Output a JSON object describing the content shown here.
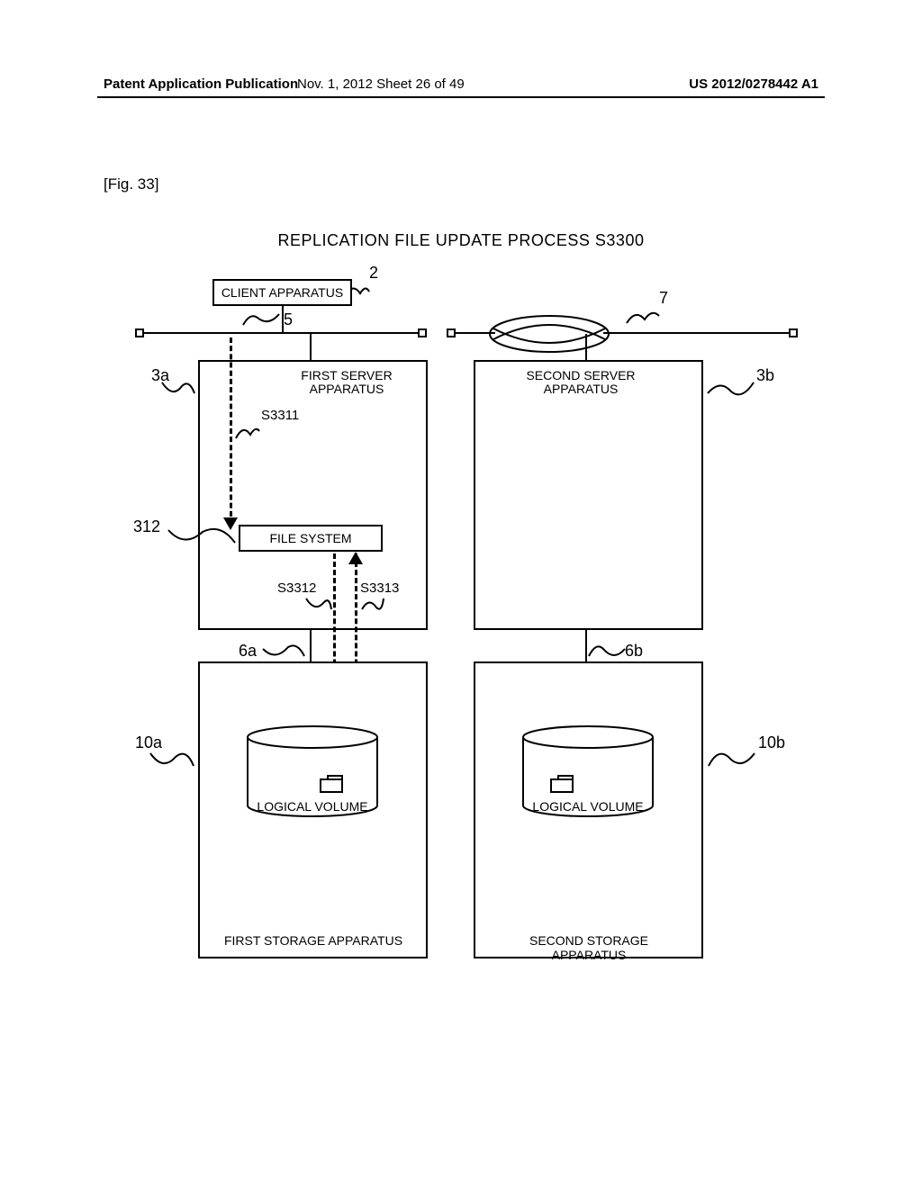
{
  "header": {
    "left": "Patent Application Publication",
    "center": "Nov. 1, 2012  Sheet 26 of 49",
    "right": "US 2012/0278442 A1"
  },
  "fig_label": "[Fig. 33]",
  "title": "REPLICATION FILE UPDATE PROCESS S3300",
  "diagram": {
    "client": "CLIENT APPARATUS",
    "first_server": "FIRST SERVER\nAPPARATUS",
    "second_server": "SECOND SERVER\nAPPARATUS",
    "file_system": "FILE SYSTEM",
    "logical_volume": "LOGICAL VOLUME",
    "first_storage": "FIRST STORAGE APPARATUS",
    "second_storage": "SECOND STORAGE APPARATUS"
  },
  "refs": {
    "r2": "2",
    "r5": "5",
    "r7": "7",
    "r3a": "3a",
    "r3b": "3b",
    "r312": "312",
    "s3311": "S3311",
    "s3312": "S3312",
    "s3313": "S3313",
    "r6a": "6a",
    "r6b": "6b",
    "r10a": "10a",
    "r10b": "10b"
  }
}
